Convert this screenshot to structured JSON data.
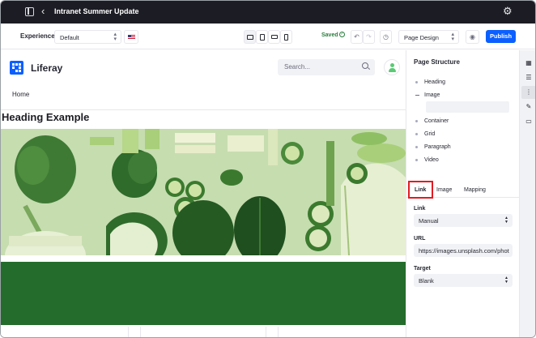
{
  "topbar": {
    "title": "Intranet Summer Update",
    "back_icon": "chevron-left-icon",
    "settings_icon": "gear-icon"
  },
  "toolbar": {
    "experience_label": "Experience",
    "experience_value": "Default",
    "language_flag": "flag-us-icon",
    "devices": [
      "desktop-icon",
      "tablet-icon",
      "landscape-phone-icon",
      "portrait-phone-icon"
    ],
    "saved_label": "Saved",
    "undo_icon": "undo-icon",
    "redo_icon": "redo-icon",
    "history_icon": "history-icon",
    "mode_value": "Page Design",
    "preview_icon": "eye-icon",
    "publish_label": "Publish"
  },
  "site": {
    "brand": "Liferay",
    "search_placeholder": "Search...",
    "nav_home": "Home",
    "heading": "Heading Example"
  },
  "panel": {
    "title": "Page Structure",
    "tree": [
      "Heading",
      "Image",
      "image-square",
      "Container",
      "Grid",
      "Paragraph",
      "Video"
    ],
    "tabs": [
      "Link",
      "Image",
      "Mapping"
    ],
    "link_label": "Link",
    "link_value": "Manual",
    "url_label": "URL",
    "url_value": "https://images.unsplash.com/phot",
    "target_label": "Target",
    "target_value": "Blank"
  },
  "rail": [
    "fragments-icon",
    "widgets-icon",
    "page-structure-icon",
    "look-and-feel-icon",
    "comments-icon"
  ],
  "colors": {
    "accent": "#0b5fff",
    "topbar": "#1c1c24",
    "saved": "#287d3c",
    "green_section": "#246c2b",
    "highlight": "#e31b23"
  }
}
